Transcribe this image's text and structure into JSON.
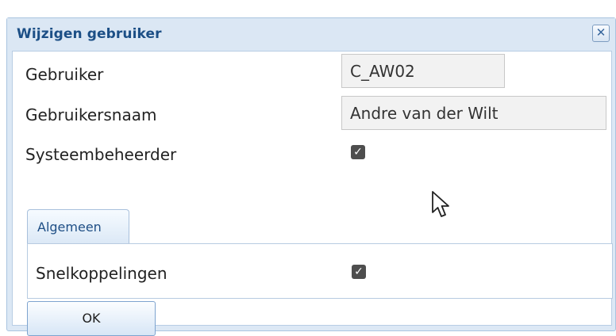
{
  "dialog": {
    "title": "Wijzigen gebruiker",
    "close_icon": "close-icon",
    "close_label": "✕"
  },
  "fields": {
    "user_label": "Gebruiker",
    "user_value": "C_AW02",
    "username_label": "Gebruikersnaam",
    "username_value": "Andre van der Wilt",
    "sysadmin_label": "Systeembeheerder",
    "sysadmin_checked": true
  },
  "tabs": [
    {
      "label": "Algemeen",
      "active": true
    }
  ],
  "tab_content": {
    "shortcuts_label": "Snelkoppelingen",
    "shortcuts_checked": true
  },
  "buttons": {
    "ok_label": "OK"
  },
  "checkbox_mark": "✓",
  "colors": {
    "title": "#1c4f86",
    "header_bg": "#dbe7f4",
    "border": "#a9c4e0"
  },
  "icons": {
    "checkbox": "checkmark-icon",
    "cursor": "mouse-pointer-icon"
  }
}
